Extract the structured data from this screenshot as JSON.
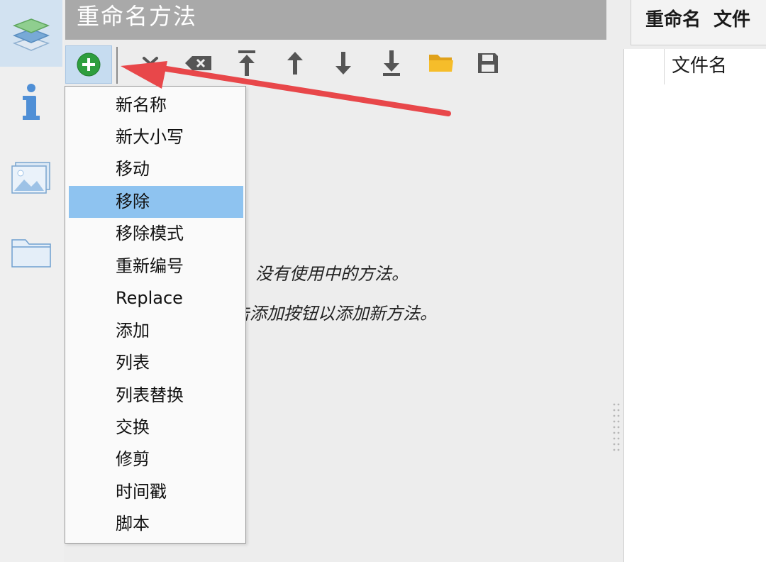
{
  "title": "重命名方法",
  "sidebar": {
    "items": [
      {
        "id": "methods",
        "icon": "layers-icon",
        "active": true
      },
      {
        "id": "info",
        "icon": "info-icon",
        "active": false
      },
      {
        "id": "images",
        "icon": "images-icon",
        "active": false
      },
      {
        "id": "folder",
        "icon": "folder-icon",
        "active": false
      }
    ]
  },
  "toolbar": {
    "buttons": [
      {
        "id": "add",
        "icon": "add-circle-icon",
        "color": "#2e9e3e"
      },
      {
        "id": "remove",
        "icon": "x-icon"
      },
      {
        "id": "clear",
        "icon": "backspace-icon"
      },
      {
        "id": "move-top",
        "icon": "arrow-to-top-icon"
      },
      {
        "id": "move-up",
        "icon": "arrow-up-icon"
      },
      {
        "id": "move-down",
        "icon": "arrow-down-icon"
      },
      {
        "id": "move-bottom",
        "icon": "arrow-to-bottom-icon"
      },
      {
        "id": "open",
        "icon": "folder-open-icon",
        "color": "#f3b321"
      },
      {
        "id": "save",
        "icon": "save-icon"
      }
    ]
  },
  "dropdown": {
    "items": [
      {
        "label": "新名称",
        "selected": false
      },
      {
        "label": "新大小写",
        "selected": false
      },
      {
        "label": "移动",
        "selected": false
      },
      {
        "label": "移除",
        "selected": true
      },
      {
        "label": "移除模式",
        "selected": false
      },
      {
        "label": "重新编号",
        "selected": false
      },
      {
        "label": "Replace",
        "selected": false
      },
      {
        "label": "添加",
        "selected": false
      },
      {
        "label": "列表",
        "selected": false
      },
      {
        "label": "列表替换",
        "selected": false
      },
      {
        "label": "交换",
        "selected": false
      },
      {
        "label": "修剪",
        "selected": false
      },
      {
        "label": "时间戳",
        "selected": false
      },
      {
        "label": "脚本",
        "selected": false
      }
    ]
  },
  "empty_state": {
    "line1": "没有使用中的方法。",
    "line2": "击添加按钮以添加新方法。"
  },
  "right_panel": {
    "tabs": [
      "重命名",
      "文件"
    ],
    "column_header": "文件名"
  },
  "colors": {
    "accent": "#8ec3f0",
    "arrow": "#e8474a",
    "title_bg": "#a9a9a9"
  }
}
